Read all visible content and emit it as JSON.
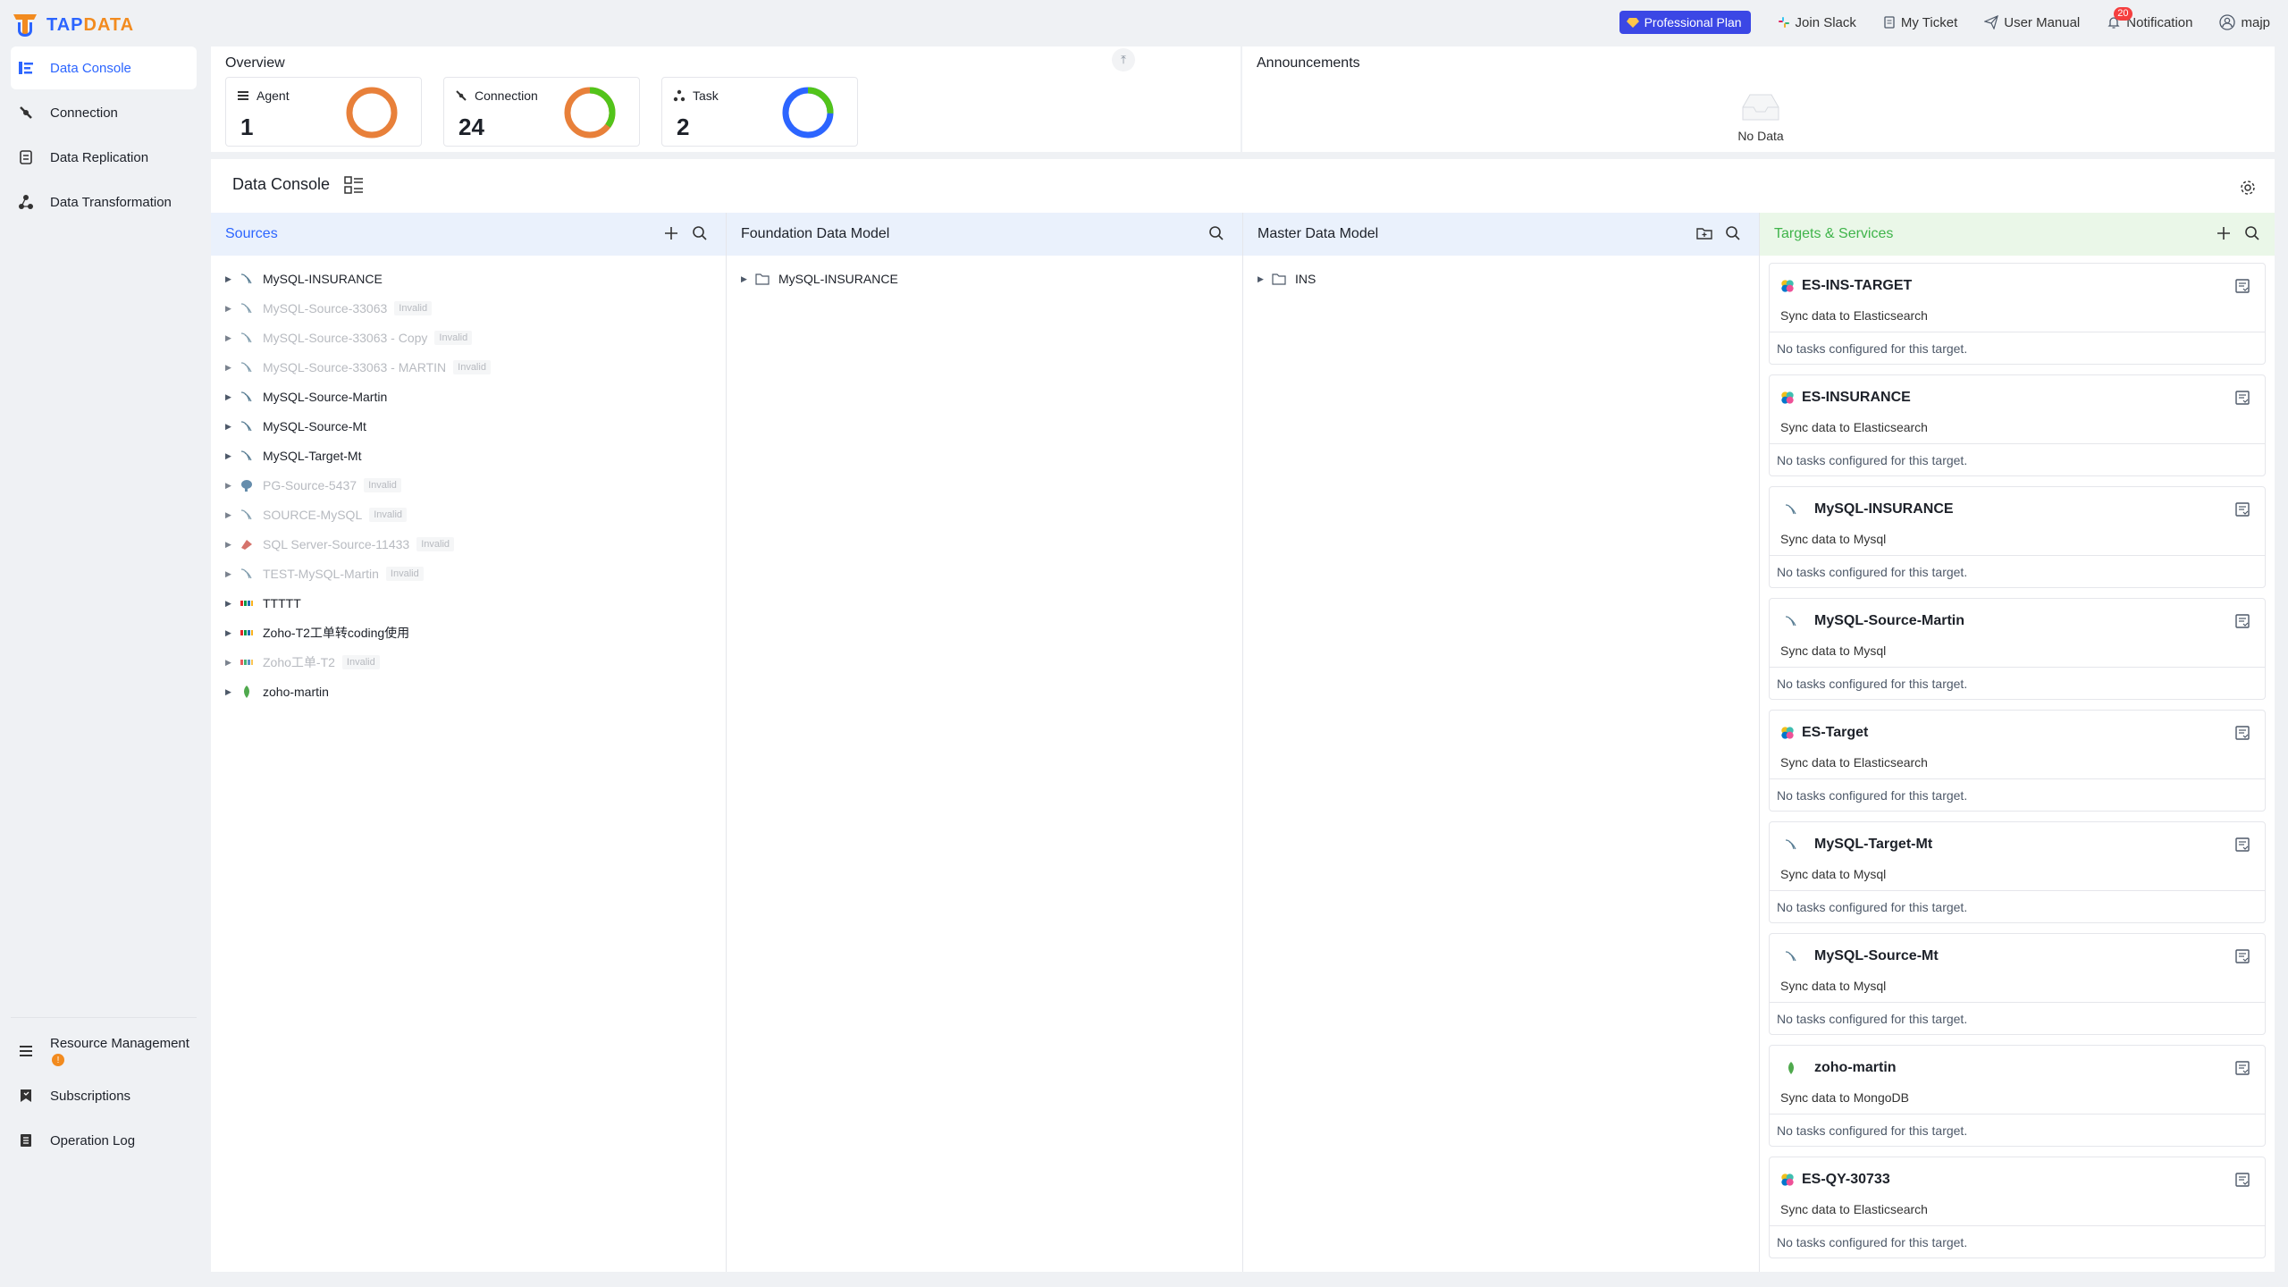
{
  "brand": {
    "logo_text_blue": "TAP",
    "logo_text_orange": "DATA"
  },
  "topnav": {
    "plan": "Professional Plan",
    "slack": "Join Slack",
    "ticket": "My Ticket",
    "manual": "User Manual",
    "notification": "Notification",
    "notification_count": "20",
    "user": "majp"
  },
  "sidebar": {
    "items": [
      {
        "label": "Data Console",
        "icon": "console-icon"
      },
      {
        "label": "Connection",
        "icon": "connection-icon"
      },
      {
        "label": "Data Replication",
        "icon": "replication-icon"
      },
      {
        "label": "Data Transformation",
        "icon": "transformation-icon"
      }
    ],
    "bottom": [
      {
        "label": "Resource Management",
        "icon": "resource-icon"
      },
      {
        "label": "Subscriptions",
        "icon": "subscription-icon"
      },
      {
        "label": "Operation Log",
        "icon": "log-icon"
      }
    ],
    "resource_badge": "!"
  },
  "overview": {
    "title": "Overview",
    "cards": [
      {
        "label": "Agent",
        "value": "1",
        "ring_color": "#e8803a"
      },
      {
        "label": "Connection",
        "value": "24",
        "ring_color": "#e8803a"
      },
      {
        "label": "Task",
        "value": "2",
        "ring_color": "#2c65ff"
      }
    ]
  },
  "announcements": {
    "title": "Announcements",
    "empty": "No Data"
  },
  "console": {
    "title": "Data Console",
    "columns": {
      "sources": {
        "title": "Sources"
      },
      "fdm": {
        "title": "Foundation Data Model",
        "items": [
          {
            "name": "MySQL-INSURANCE"
          }
        ]
      },
      "mdm": {
        "title": "Master Data Model",
        "items": [
          {
            "name": "INS"
          }
        ]
      },
      "targets": {
        "title": "Targets & Services"
      }
    },
    "invalid_label": "Invalid",
    "sources": [
      {
        "name": "MySQL-INSURANCE",
        "invalid": false,
        "type": "mysql"
      },
      {
        "name": "MySQL-Source-33063",
        "invalid": true,
        "type": "mysql"
      },
      {
        "name": "MySQL-Source-33063 - Copy",
        "invalid": true,
        "type": "mysql"
      },
      {
        "name": "MySQL-Source-33063 - MARTIN",
        "invalid": true,
        "type": "mysql"
      },
      {
        "name": "MySQL-Source-Martin",
        "invalid": false,
        "type": "mysql"
      },
      {
        "name": "MySQL-Source-Mt",
        "invalid": false,
        "type": "mysql"
      },
      {
        "name": "MySQL-Target-Mt",
        "invalid": false,
        "type": "mysql"
      },
      {
        "name": "PG-Source-5437",
        "invalid": true,
        "type": "postgres"
      },
      {
        "name": "SOURCE-MySQL",
        "invalid": true,
        "type": "mysql"
      },
      {
        "name": "SQL Server-Source-11433",
        "invalid": true,
        "type": "sqlserver"
      },
      {
        "name": "TEST-MySQL-Martin",
        "invalid": true,
        "type": "mysql"
      },
      {
        "name": "TTTTT",
        "invalid": false,
        "type": "zoho"
      },
      {
        "name": "Zoho-T2工单转coding使用",
        "invalid": false,
        "type": "zoho"
      },
      {
        "name": "Zoho工单-T2",
        "invalid": true,
        "type": "zoho"
      },
      {
        "name": "zoho-martin",
        "invalid": false,
        "type": "mongodb"
      }
    ],
    "targets": [
      {
        "name": "ES-INS-TARGET",
        "desc": "Sync data to Elasticsearch",
        "footer": "No tasks configured for this target.",
        "type": "es"
      },
      {
        "name": "ES-INSURANCE",
        "desc": "Sync data to Elasticsearch",
        "footer": "No tasks configured for this target.",
        "type": "es"
      },
      {
        "name": "MySQL-INSURANCE",
        "desc": "Sync data to Mysql",
        "footer": "No tasks configured for this target.",
        "type": "mysql"
      },
      {
        "name": "MySQL-Source-Martin",
        "desc": "Sync data to Mysql",
        "footer": "No tasks configured for this target.",
        "type": "mysql"
      },
      {
        "name": "ES-Target",
        "desc": "Sync data to Elasticsearch",
        "footer": "No tasks configured for this target.",
        "type": "es"
      },
      {
        "name": "MySQL-Target-Mt",
        "desc": "Sync data to Mysql",
        "footer": "No tasks configured for this target.",
        "type": "mysql"
      },
      {
        "name": "MySQL-Source-Mt",
        "desc": "Sync data to Mysql",
        "footer": "No tasks configured for this target.",
        "type": "mysql"
      },
      {
        "name": "zoho-martin",
        "desc": "Sync data to MongoDB",
        "footer": "No tasks configured for this target.",
        "type": "mongodb"
      },
      {
        "name": "ES-QY-30733",
        "desc": "Sync data to Elasticsearch",
        "footer": "No tasks configured for this target.",
        "type": "es"
      }
    ]
  }
}
